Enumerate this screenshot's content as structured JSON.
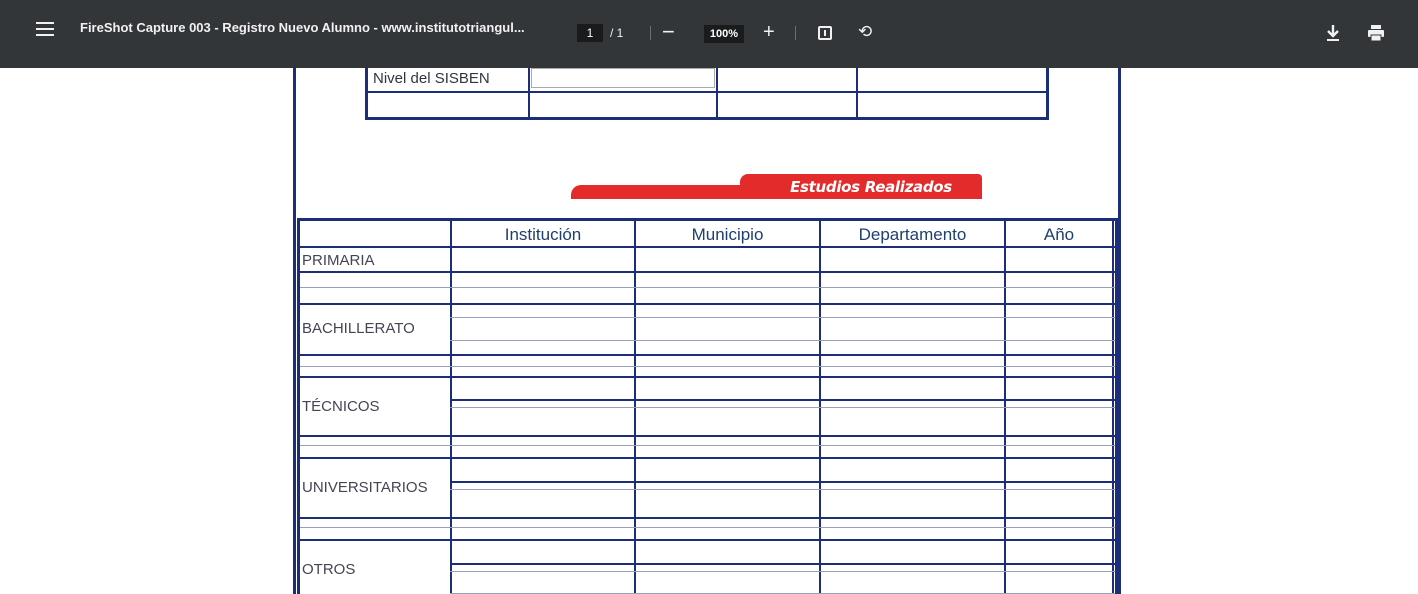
{
  "toolbar": {
    "title": "FireShot Capture 003 - Registro Nuevo Alumno - www.institutotriangul...",
    "page_current": "1",
    "page_total": "/ 1",
    "zoom": "100%",
    "zoom_out": "−",
    "zoom_in": "+",
    "rotate": "⟲",
    "more": "⋮"
  },
  "icons": [
    "menu-icon",
    "zoom-out-icon",
    "zoom-in-icon",
    "fit-page-icon",
    "rotate-icon",
    "download-icon",
    "print-icon",
    "more-icon"
  ],
  "form": {
    "sisben_label": "Nivel del SISBEN",
    "section_title": "Estudios Realizados",
    "columns": [
      "Institución",
      "Municipio",
      "Departamento",
      "Año"
    ],
    "rows": [
      "PRIMARIA",
      "BACHILLERATO",
      "TÉCNICOS",
      "UNIVERSITARIOS",
      "OTROS"
    ]
  },
  "colors": {
    "toolbar": "#323639",
    "border_blue": "#1c2e7a",
    "banner_red": "#e32b2b"
  }
}
